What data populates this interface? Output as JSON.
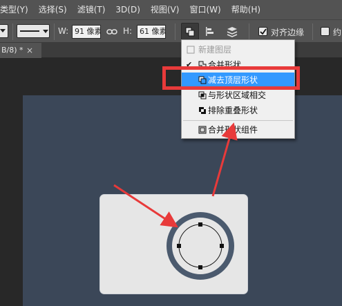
{
  "menubar": {
    "items": [
      {
        "label": "类型(Y)"
      },
      {
        "label": "选择(S)"
      },
      {
        "label": "滤镜(T)"
      },
      {
        "label": "3D(D)"
      },
      {
        "label": "视图(V)"
      },
      {
        "label": "窗口(W)"
      },
      {
        "label": "帮助(H)"
      }
    ]
  },
  "options": {
    "width_label": "W:",
    "width_value": "91 像素",
    "height_label": "H:",
    "height_value": "61 像素",
    "align_edges_label": "对齐边缘",
    "align_edges_checked": true,
    "constrain_label": "约"
  },
  "document_tab": {
    "title": "B/8) *",
    "close": "×"
  },
  "path_ops_menu": {
    "items": [
      {
        "label": "新建图层",
        "disabled": true,
        "checked": false,
        "icon": "new-layer-icon"
      },
      {
        "label": "合并形状",
        "disabled": false,
        "checked": true,
        "icon": "combine-shapes-icon"
      },
      {
        "label": "减去顶层形状",
        "disabled": false,
        "checked": false,
        "selected": true,
        "icon": "subtract-front-shape-icon"
      },
      {
        "label": "与形状区域相交",
        "disabled": false,
        "checked": false,
        "icon": "intersect-shape-areas-icon"
      },
      {
        "label": "排除重叠形状",
        "disabled": false,
        "checked": false,
        "icon": "exclude-overlapping-shapes-icon"
      },
      {
        "label": "合并形状组件",
        "disabled": false,
        "checked": false,
        "icon": "merge-shape-components-icon"
      }
    ],
    "check_mark": "✔"
  },
  "colors": {
    "ui_panel": "#535353",
    "canvas": "#3b4758",
    "highlight": "#e83a3a",
    "selected_item": "#3399ff",
    "ring": "#4b5a6e"
  }
}
